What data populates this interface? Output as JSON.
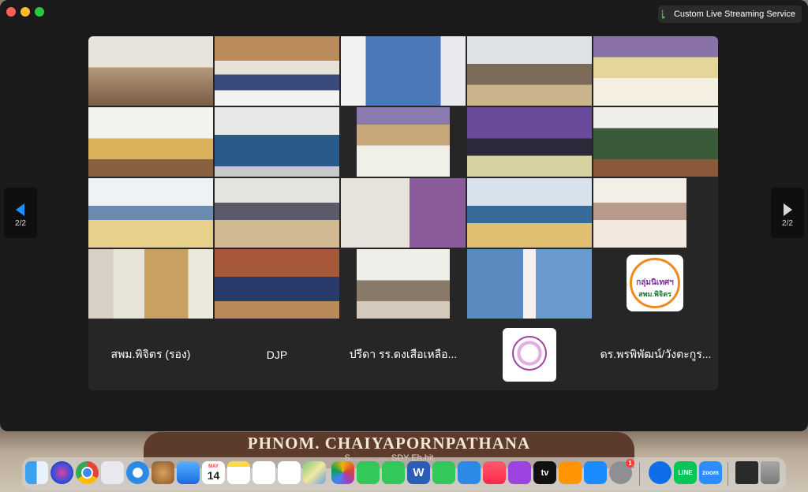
{
  "window": {
    "stream_badge": "Custom Live Streaming Service"
  },
  "navigation": {
    "prev_page_label": "2/2",
    "next_page_label": "2/2"
  },
  "participants": [
    {
      "type": "video",
      "desc": "classroom-with-lights"
    },
    {
      "type": "video",
      "desc": "meeting-room-row"
    },
    {
      "type": "video",
      "desc": "computer-room"
    },
    {
      "type": "video",
      "desc": "conference-tables"
    },
    {
      "type": "video",
      "desc": "yellow-tables-room"
    },
    {
      "type": "video",
      "desc": "meeting-yellow-tables"
    },
    {
      "type": "video",
      "desc": "screen-share"
    },
    {
      "type": "video",
      "desc": "long-hall"
    },
    {
      "type": "video",
      "desc": "purple-stage"
    },
    {
      "type": "video",
      "desc": "group-standing"
    },
    {
      "type": "video",
      "desc": "long-tables"
    },
    {
      "type": "video",
      "desc": "training-room"
    },
    {
      "type": "video",
      "desc": "man-at-laptop"
    },
    {
      "type": "video",
      "desc": "blue-curtains-room"
    },
    {
      "type": "video",
      "desc": "flower-tables"
    },
    {
      "type": "video",
      "desc": "man-closeup"
    },
    {
      "type": "video",
      "desc": "group-at-table"
    },
    {
      "type": "video",
      "desc": "hall-long-table"
    },
    {
      "type": "video",
      "desc": "laptop-desk"
    },
    {
      "type": "logo",
      "logo_line1": "กลุ่มนิเทศฯ",
      "logo_line2": "สพม.พิจิตร"
    },
    {
      "type": "name",
      "name": "สพม.พิจิตร (รอง)"
    },
    {
      "type": "name",
      "name": "DJP"
    },
    {
      "type": "name",
      "name": "ปรีดา รร.ดงเสือเหลือ..."
    },
    {
      "type": "logo-small",
      "desc": "school-emblem"
    },
    {
      "type": "name",
      "name": "ดร.พรพิพัฒน์/วังตะกูร..."
    }
  ],
  "wallpaper": {
    "banner_line1": "PHNOM. CHAIYAPORNPATHANA",
    "banner_line2": "S................ SDY Eh.hit"
  },
  "dock": {
    "calendar_month": "MAY",
    "calendar_day": "14",
    "word_letter": "W",
    "settings_badge": "1",
    "line_label": "LINE",
    "zoom_label": "zoom",
    "appletv_label": "tv",
    "items": [
      "finder-icon",
      "siri-icon",
      "chrome-icon",
      "launchpad-icon",
      "safari-icon",
      "bronze-app-icon",
      "mail-icon",
      "calendar-icon",
      "notes-icon",
      "freeform-icon",
      "reminders-icon",
      "maps-icon",
      "photos-icon",
      "messages-icon",
      "facetime-icon",
      "word-icon",
      "numbers-icon",
      "keynote-icon",
      "music-icon",
      "podcasts-icon",
      "appletv-icon",
      "books-icon",
      "appstore-icon",
      "settings-icon",
      "teamviewer-icon",
      "line-icon",
      "zoom-icon",
      "window-thumbnail-icon",
      "trash-icon"
    ]
  },
  "colors": {
    "grid_bg": "#262626",
    "window_bg": "#1a1a1a",
    "accent": "#1e90ff"
  }
}
